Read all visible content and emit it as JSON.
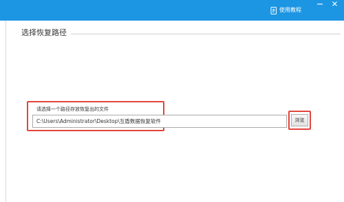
{
  "header": {
    "help_label": "使用教程",
    "icons": {
      "help": "document-help-icon",
      "minimize": "minimize-icon",
      "close": "close-icon"
    },
    "colors": {
      "titlebar": "#1c95e2",
      "highlight": "#e2433a"
    }
  },
  "section": {
    "title": "选择恢复路径"
  },
  "path": {
    "label": "请选择一个路径存放恢复出的文件",
    "value": "C:\\Users\\Administrator\\Desktop\\互盾数据恢复软件",
    "browse_label": "浏览"
  }
}
